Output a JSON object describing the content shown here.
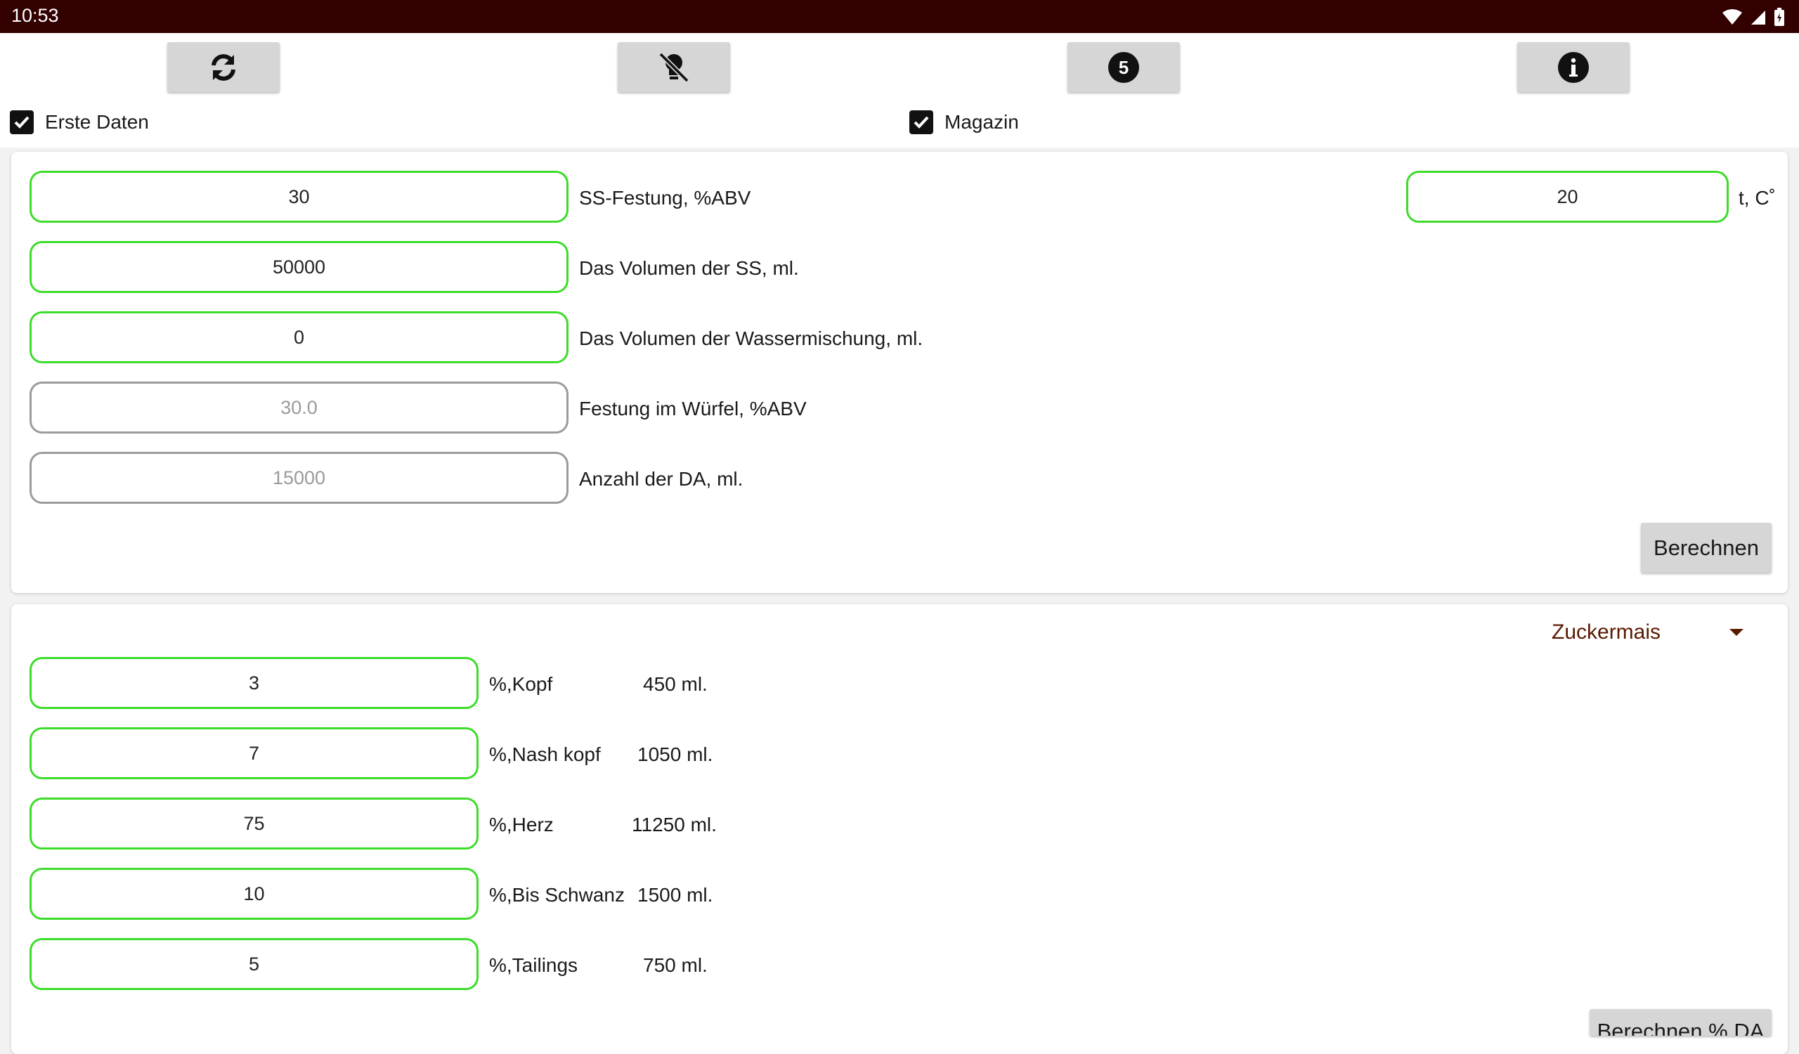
{
  "status_bar": {
    "time": "10:53"
  },
  "toolbar": {
    "buttons": [
      {
        "name": "refresh-button",
        "icon": "refresh-icon"
      },
      {
        "name": "lamp-off-button",
        "icon": "lamp-off-icon"
      },
      {
        "name": "five-button",
        "icon": "number-five-icon"
      },
      {
        "name": "info-button",
        "icon": "info-icon"
      }
    ],
    "checkboxes": [
      {
        "label": "Erste Daten",
        "checked": true
      },
      {
        "label": "Magazin",
        "checked": true
      }
    ]
  },
  "card1": {
    "rows": [
      {
        "value": "30",
        "label": "SS-Festung, %ABV",
        "editable": true
      },
      {
        "value": "50000",
        "label": "Das Volumen der SS, ml.",
        "editable": true
      },
      {
        "value": "0",
        "label": "Das Volumen der Wassermischung, ml.",
        "editable": true
      },
      {
        "value": "30.0",
        "label": "Festung im Würfel, %ABV",
        "editable": false
      },
      {
        "value": "15000",
        "label": "Anzahl der DA, ml.",
        "editable": false
      }
    ],
    "temperature": {
      "value": "20",
      "label": "t, C˚"
    },
    "calc_button": "Berechnen"
  },
  "card2": {
    "dropdown": {
      "selected": "Zuckermais"
    },
    "rows": [
      {
        "value": "3",
        "label": "%,Kopf",
        "result": "450 ml."
      },
      {
        "value": "7",
        "label": "%,Nash kopf",
        "result": "1050 ml."
      },
      {
        "value": "75",
        "label": "%,Herz",
        "result": "11250 ml."
      },
      {
        "value": "10",
        "label": "%,Bis Schwanz",
        "result": "1500 ml."
      },
      {
        "value": "5",
        "label": "%,Tailings",
        "result": "750 ml."
      }
    ],
    "calc_button": "Berechnen % DA"
  },
  "colors": {
    "status_bar": "#330000",
    "field_border_active": "#3ddc2a",
    "field_border_disabled": "#9b9b9b",
    "button_bg": "#d6d6d6",
    "dropdown_text": "#5a1a00"
  }
}
